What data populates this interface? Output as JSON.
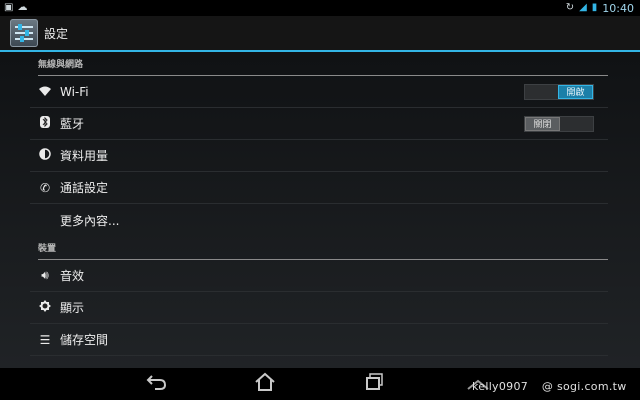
{
  "status_bar": {
    "time": "10:40"
  },
  "action_bar": {
    "title": "設定"
  },
  "sections": [
    {
      "header": "無線與網路"
    },
    {
      "header": "裝置"
    }
  ],
  "rows": {
    "wifi": {
      "label": "Wi-Fi",
      "toggle": "開啟"
    },
    "bluetooth": {
      "label": "藍牙",
      "toggle": "關閉"
    },
    "data_usage": {
      "label": "資料用量"
    },
    "call_settings": {
      "label": "通話設定"
    },
    "more": {
      "label": "更多內容..."
    },
    "sound": {
      "label": "音效"
    },
    "display": {
      "label": "顯示"
    },
    "storage": {
      "label": "儲存空間"
    }
  },
  "watermark": {
    "user": "kelly0907",
    "site": "@ sogi.com.tw"
  }
}
